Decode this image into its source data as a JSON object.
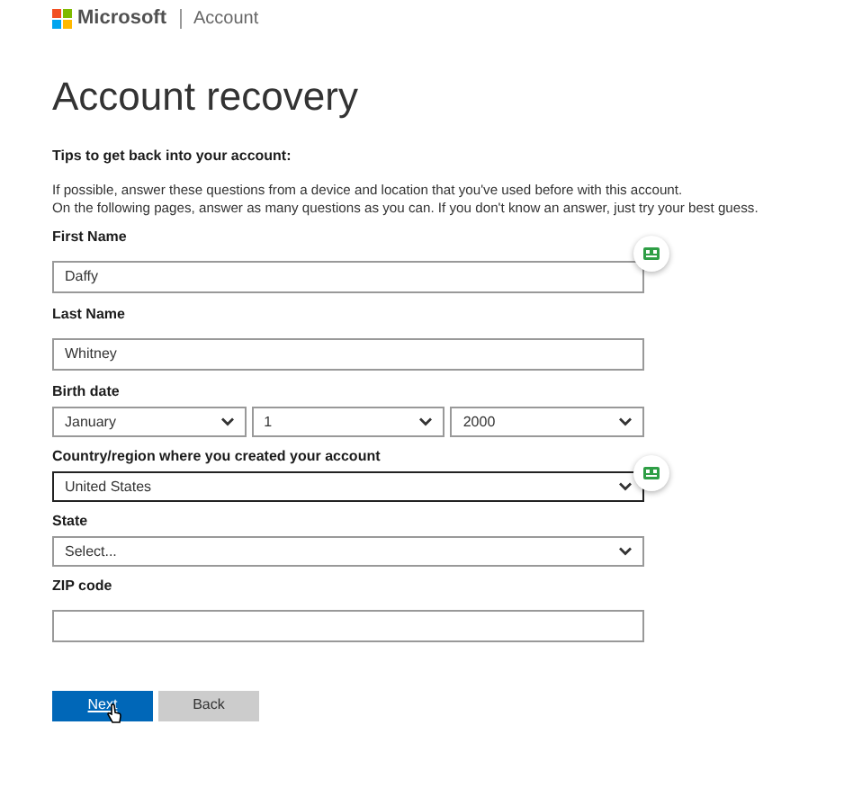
{
  "header": {
    "brand": "Microsoft",
    "section": "Account"
  },
  "title": "Account recovery",
  "tips_heading": "Tips to get back into your account:",
  "tips": [
    "If possible, answer these questions from a device and location that you've used before with this account.",
    "On the following pages, answer as many questions as you can. If you don't know an answer, just try your best guess."
  ],
  "fields": [
    {
      "label": "First Name",
      "kind": "text",
      "value": "Daffy",
      "focused": false,
      "autofill": true
    },
    {
      "label": "Last Name",
      "kind": "text",
      "value": "Whitney",
      "focused": false,
      "autofill": false
    },
    {
      "label": "Birth date",
      "kind": "date",
      "parts": [
        "January",
        "1",
        "2000"
      ],
      "focused": false,
      "autofill": false
    },
    {
      "label": "Country/region where you created your account",
      "kind": "select",
      "value": "United States",
      "focused": true,
      "autofill": true
    },
    {
      "label": "State",
      "kind": "select",
      "value": "Select...",
      "focused": false,
      "autofill": false
    },
    {
      "label": "ZIP code",
      "kind": "text",
      "focused": false,
      "autofill": false
    }
  ],
  "buttons": [
    {
      "label": "Next",
      "kind": "primary",
      "hovered": true
    },
    {
      "label": "Back",
      "kind": "secondary",
      "hovered": false
    }
  ]
}
